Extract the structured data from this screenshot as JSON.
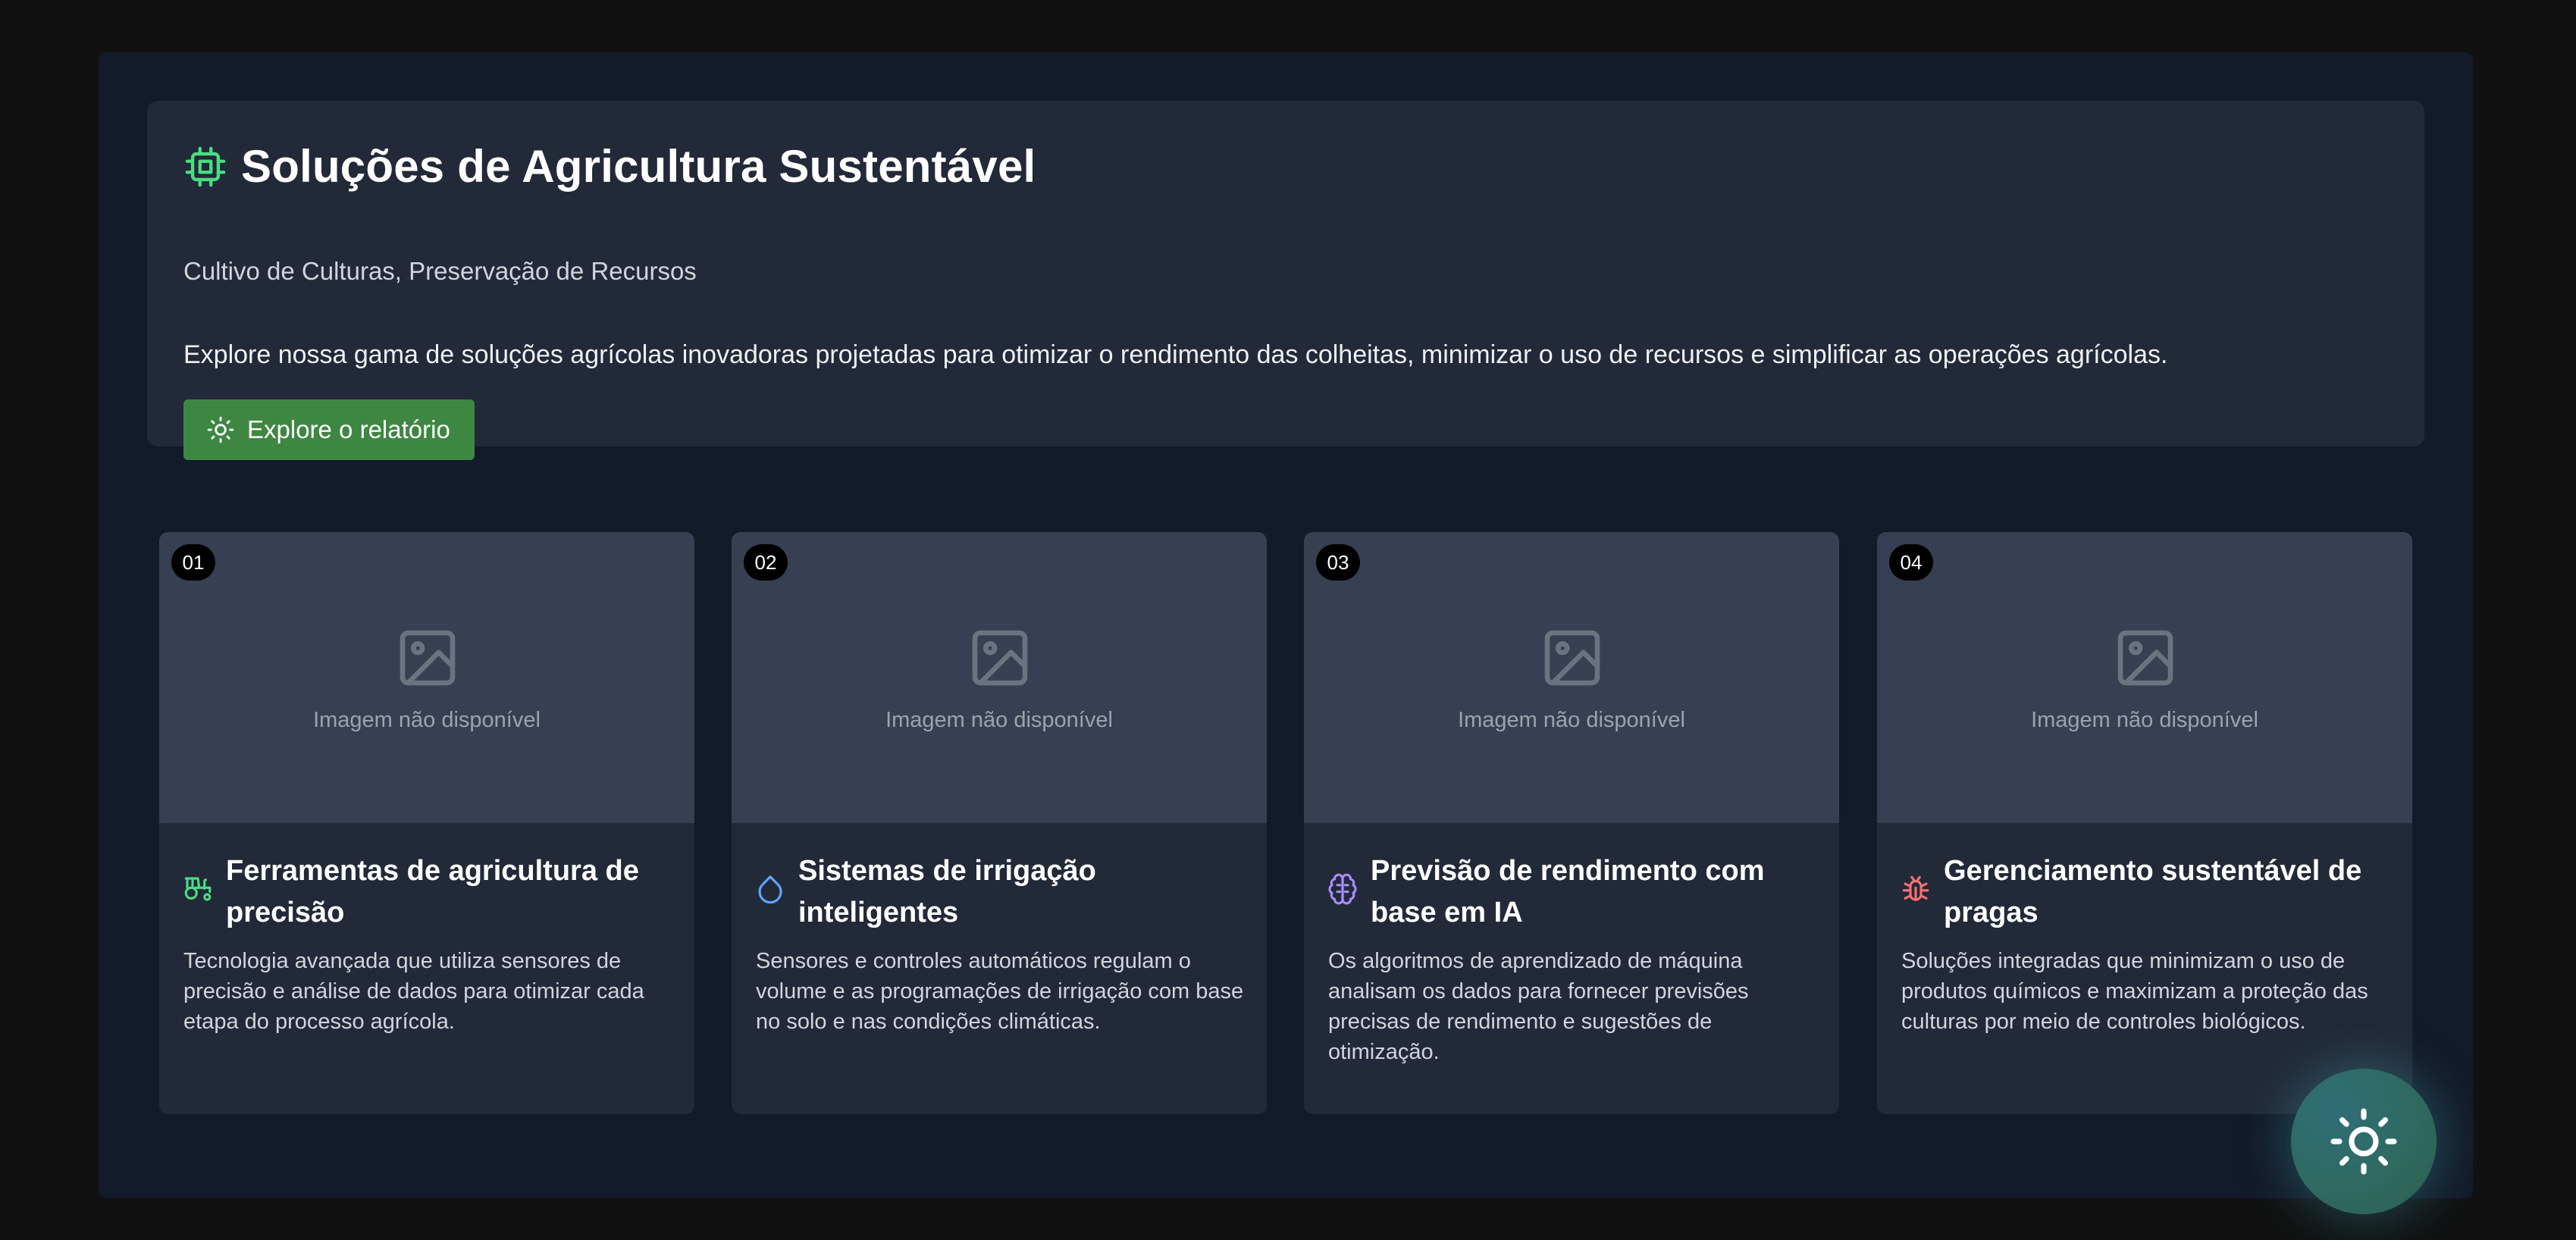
{
  "hero": {
    "title": "Soluções de Agricultura Sustentável",
    "subtitle": "Cultivo de Culturas, Preservação de Recursos",
    "description": "Explore nossa gama de soluções agrícolas inovadoras projetadas para otimizar o rendimento das colheitas, minimizar o uso de recursos e simplificar as operações agrícolas.",
    "cta_label": "Explore o relatório",
    "title_icon": "chip-icon",
    "cta_icon": "sun-icon"
  },
  "cards": [
    {
      "number": "01",
      "placeholder": "Imagem não disponível",
      "title": "Ferramentas de agricultura de precisão",
      "description": "Tecnologia avançada que utiliza sensores de precisão e análise de dados para otimizar cada etapa do processo agrícola.",
      "icon": "tractor-icon",
      "icon_color": "#4ade80"
    },
    {
      "number": "02",
      "placeholder": "Imagem não disponível",
      "title": "Sistemas de irrigação inteligentes",
      "description": "Sensores e controles automáticos regulam o volume e as programações de irrigação com base no solo e nas condições climáticas.",
      "icon": "droplet-icon",
      "icon_color": "#60a5fa"
    },
    {
      "number": "03",
      "placeholder": "Imagem não disponível",
      "title": "Previsão de rendimento com base em IA",
      "description": "Os algoritmos de aprendizado de máquina analisam os dados para fornecer previsões precisas de rendimento e sugestões de otimização.",
      "icon": "brain-icon",
      "icon_color": "#a78bfa"
    },
    {
      "number": "04",
      "placeholder": "Imagem não disponível",
      "title": "Gerenciamento sustentável de pragas",
      "description": "Soluções integradas que minimizam o uso de produtos químicos e maximizam a proteção das culturas por meio de controles biológicos.",
      "icon": "bug-icon",
      "icon_color": "#f87171"
    }
  ],
  "theme_toggle": {
    "icon": "sun-icon"
  },
  "colors": {
    "accent_green": "#3e8742",
    "page_bg": "#111111",
    "panel_bg": "#222938"
  }
}
